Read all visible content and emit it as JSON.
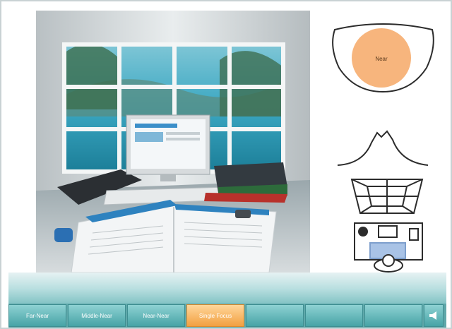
{
  "lens_view": {
    "zone_label": "Near",
    "zone_color": "#f7b57d"
  },
  "toolbar": {
    "buttons": [
      {
        "label": "Far-Near"
      },
      {
        "label": "Middle-Near"
      },
      {
        "label": "Near-Near"
      },
      {
        "label": "Single Focus",
        "active": true
      }
    ],
    "sound_icon": "speaker-icon"
  }
}
